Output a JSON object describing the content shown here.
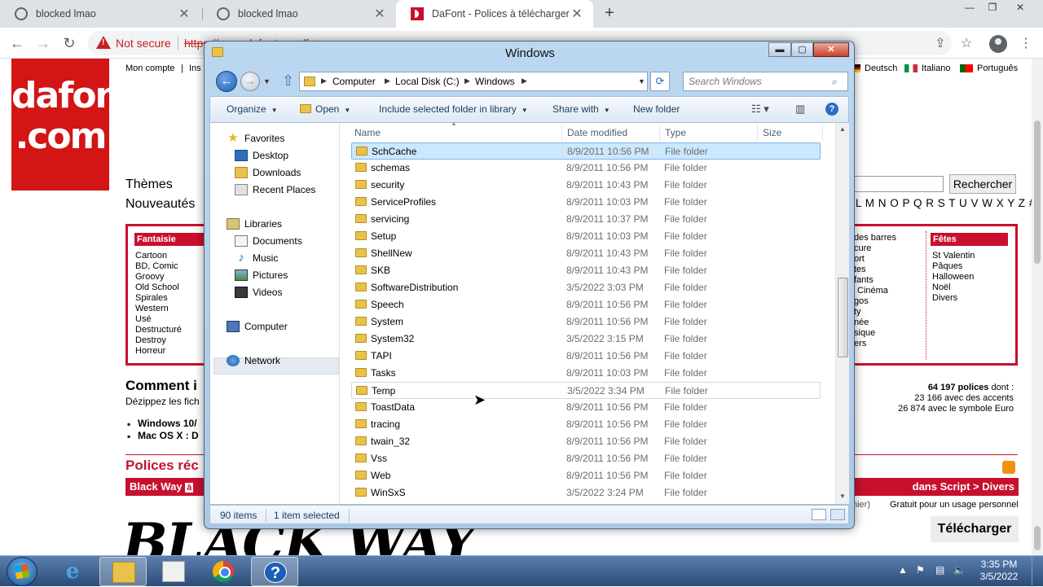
{
  "browser": {
    "tabs": [
      {
        "title": "blocked lmao",
        "close": "✕"
      },
      {
        "title": "blocked lmao",
        "close": "✕"
      },
      {
        "title": "DaFont - Polices à télécharger",
        "close": "✕"
      }
    ],
    "new_tab": "+",
    "window_buttons": {
      "minimize": "—",
      "restore": "❐",
      "close": "✕"
    },
    "nav": {
      "back": "←",
      "forward": "→",
      "reload": "↻"
    },
    "security_label": "Not secure",
    "url": "https://www.dafont.com/fr/",
    "icons": {
      "share": "⇪",
      "bookmark": "☆",
      "menu": "⋮"
    }
  },
  "dafont": {
    "logo_line1": "dafont",
    "logo_line2": ".com",
    "top_links": [
      "Mon compte",
      "|",
      "Ins"
    ],
    "languages": [
      "Deutsch",
      "Italiano",
      "Português"
    ],
    "themes_label": "Thèmes",
    "new_label": "Nouveautés",
    "search_button": "Rechercher",
    "alphabet": "L M N O P Q R S T U V W X Y Z #",
    "fantaisie": {
      "title": "Fantaisie",
      "items": [
        "Cartoon",
        "BD, Comic",
        "Groovy",
        "Old School",
        "Spirales",
        "Western",
        "Usé",
        "Destructuré",
        "Destroy",
        "Horreur"
      ]
    },
    "middle_partial": [
      "des barres",
      "cure",
      "ort",
      "tes",
      "fants",
      "Cinéma",
      "gos",
      "ty",
      "née",
      "sique",
      "ers"
    ],
    "fetes": {
      "title": "Fêtes",
      "items": [
        "St Valentin",
        "Pâques",
        "Halloween",
        "Noël",
        "Divers"
      ]
    },
    "comment_heading": "Comment i",
    "unzip_text": "Dézippez les fich",
    "windows_item": "Windows 10/",
    "mac_item": "Mac OS X : D",
    "stats_count": "64 197 polices",
    "stats_suffix": " dont :",
    "stats_accents": "23 166 avec des accents",
    "stats_euro": "26 874 avec le symbole Euro",
    "polices_heading": "Polices réc",
    "font_name": "Black Way",
    "font_badge": "à",
    "font_category": "dans Script > Divers",
    "yesterday": "hier)",
    "license": "Gratuit pour un usage personnel",
    "download_button": "Télécharger",
    "preview_text": "BLACK WAY"
  },
  "explorer": {
    "title": "Windows",
    "caption": {
      "minimize": "▬",
      "maximize": "▢",
      "close": "✕"
    },
    "back": "←",
    "forward": "→",
    "breadcrumb": [
      "Computer",
      "Local Disk (C:)",
      "Windows"
    ],
    "search_placeholder": "Search Windows",
    "commands": {
      "organize": "Organize",
      "open": "Open",
      "include": "Include selected folder in library",
      "share": "Share with",
      "new_folder": "New folder"
    },
    "nav_pane": {
      "favorites": "Favorites",
      "desktop": "Desktop",
      "downloads": "Downloads",
      "recent": "Recent Places",
      "libraries": "Libraries",
      "documents": "Documents",
      "music": "Music",
      "pictures": "Pictures",
      "videos": "Videos",
      "computer": "Computer",
      "network": "Network"
    },
    "columns": {
      "name": "Name",
      "date": "Date modified",
      "type": "Type",
      "size": "Size"
    },
    "files": [
      {
        "name": "SchCache",
        "date": "8/9/2011 10:56 PM",
        "type": "File folder"
      },
      {
        "name": "schemas",
        "date": "8/9/2011 10:56 PM",
        "type": "File folder"
      },
      {
        "name": "security",
        "date": "8/9/2011 10:43 PM",
        "type": "File folder"
      },
      {
        "name": "ServiceProfiles",
        "date": "8/9/2011 10:03 PM",
        "type": "File folder"
      },
      {
        "name": "servicing",
        "date": "8/9/2011 10:37 PM",
        "type": "File folder"
      },
      {
        "name": "Setup",
        "date": "8/9/2011 10:03 PM",
        "type": "File folder"
      },
      {
        "name": "ShellNew",
        "date": "8/9/2011 10:43 PM",
        "type": "File folder"
      },
      {
        "name": "SKB",
        "date": "8/9/2011 10:43 PM",
        "type": "File folder"
      },
      {
        "name": "SoftwareDistribution",
        "date": "3/5/2022 3:03 PM",
        "type": "File folder"
      },
      {
        "name": "Speech",
        "date": "8/9/2011 10:56 PM",
        "type": "File folder"
      },
      {
        "name": "System",
        "date": "8/9/2011 10:56 PM",
        "type": "File folder"
      },
      {
        "name": "System32",
        "date": "3/5/2022 3:15 PM",
        "type": "File folder"
      },
      {
        "name": "TAPI",
        "date": "8/9/2011 10:56 PM",
        "type": "File folder"
      },
      {
        "name": "Tasks",
        "date": "8/9/2011 10:03 PM",
        "type": "File folder"
      },
      {
        "name": "Temp",
        "date": "3/5/2022 3:34 PM",
        "type": "File folder"
      },
      {
        "name": "ToastData",
        "date": "8/9/2011 10:56 PM",
        "type": "File folder"
      },
      {
        "name": "tracing",
        "date": "8/9/2011 10:56 PM",
        "type": "File folder"
      },
      {
        "name": "twain_32",
        "date": "8/9/2011 10:56 PM",
        "type": "File folder"
      },
      {
        "name": "Vss",
        "date": "8/9/2011 10:56 PM",
        "type": "File folder"
      },
      {
        "name": "Web",
        "date": "8/9/2011 10:56 PM",
        "type": "File folder"
      },
      {
        "name": "WinSxS",
        "date": "3/5/2022 3:24 PM",
        "type": "File folder"
      }
    ],
    "selected_file": "SchCache",
    "hovered_file": "Temp",
    "status": {
      "items": "90 items",
      "selected": "1 item selected"
    }
  },
  "taskbar": {
    "help_label": "?",
    "clock_time": "3:35 PM",
    "clock_date": "3/5/2022",
    "tray": {
      "arrow": "▲",
      "flag": "⚑",
      "network": "▤",
      "volume": "🔈"
    }
  }
}
